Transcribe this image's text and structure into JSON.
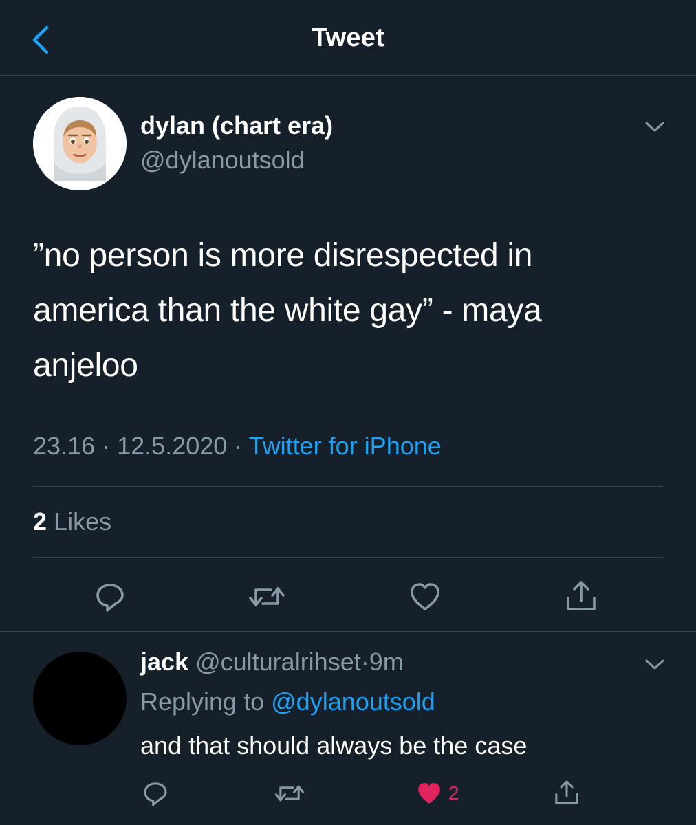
{
  "header": {
    "title": "Tweet",
    "back_icon": "chevron-left-icon"
  },
  "tweet": {
    "author_name": "dylan (chart era)",
    "author_handle": "@dylanoutsold",
    "text": "”no person is more disrespected in america than the white gay” - maya anjeloo",
    "time": "23.16",
    "date": "12.5.2020",
    "separator": "·",
    "source": "Twitter for iPhone",
    "likes_count": "2",
    "likes_label": "Likes",
    "actions": [
      "reply-icon",
      "retweet-icon",
      "like-icon",
      "share-icon"
    ]
  },
  "reply": {
    "author_name": "jack",
    "author_handle": "@culturalrihset",
    "separator": "·",
    "time": "9m",
    "replying_to_label": "Replying to",
    "replying_to_handle": "@dylanoutsold",
    "text": "and that should always be the case",
    "like_count": "2",
    "liked": true
  },
  "colors": {
    "background": "#15202b",
    "divider": "#38444d",
    "secondary_text": "#8899a6",
    "accent": "#1da1f2",
    "like": "#e0245e"
  }
}
